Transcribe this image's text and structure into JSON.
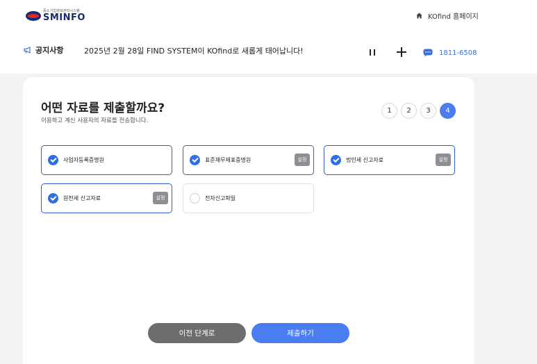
{
  "header": {
    "logo_sub": "중소기업정보관리시스템",
    "logo_main": "SMINFO",
    "home_link": "KOfind 홈페이지"
  },
  "notice": {
    "label": "공지사항",
    "text": "2025년 2월 28일 FIND SYSTEM이 KOfind로 새롭게 태어납니다!",
    "phone": "1811-6508"
  },
  "main": {
    "title": "어떤 자료를 제출할까요?",
    "subtitle": "이용하고 계신 사용자의 자료를 전송합니다.",
    "steps": [
      "1",
      "2",
      "3",
      "4"
    ],
    "active_step": "4",
    "options": [
      {
        "label": "사업자등록증명원",
        "checked": true,
        "badge": ""
      },
      {
        "label": "표준재무제표증명원",
        "checked": true,
        "badge": "설정"
      },
      {
        "label": "법인세 신고자료",
        "checked": true,
        "badge": "설정"
      },
      {
        "label": "원천세 신고자료",
        "checked": true,
        "badge": "설정"
      },
      {
        "label": "전자신고파일",
        "checked": false,
        "badge": ""
      }
    ],
    "prev_button": "이전 단계로",
    "submit_button": "제출하기"
  },
  "colors": {
    "accent": "#4a7ef0",
    "check": "#2f6fe0",
    "badge": "#8e8f93",
    "prev_button": "#6d6d6d",
    "logo_navy": "#1a2a6c",
    "logo_red": "#d62b2b"
  },
  "icons": [
    "home-icon",
    "megaphone-icon",
    "pause-icon",
    "plus-icon",
    "chat-icon",
    "check-icon"
  ]
}
